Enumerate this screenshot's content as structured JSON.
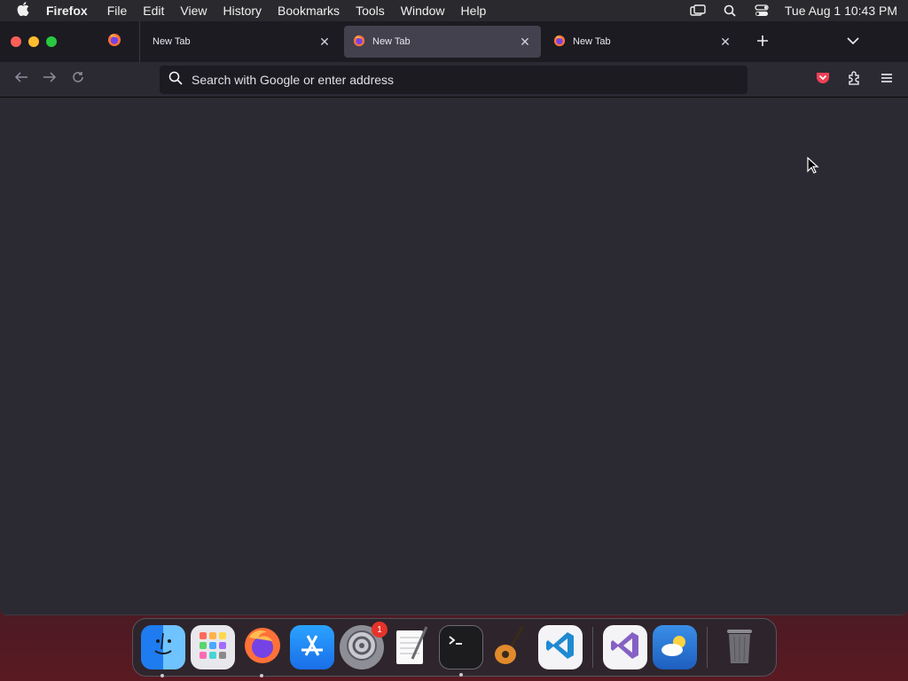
{
  "menubar": {
    "app_name": "Firefox",
    "items": [
      "File",
      "Edit",
      "View",
      "History",
      "Bookmarks",
      "Tools",
      "Window",
      "Help"
    ],
    "clock": "Tue Aug 1  10:43 PM"
  },
  "tabs": [
    {
      "label": "New Tab",
      "active": false
    },
    {
      "label": "New Tab",
      "active": true
    },
    {
      "label": "New Tab",
      "active": false
    }
  ],
  "urlbar": {
    "placeholder": "Search with Google or enter address"
  },
  "dock": {
    "items": [
      {
        "name": "Finder",
        "icon": "finder-icon"
      },
      {
        "name": "Launchpad",
        "icon": "launchpad-icon"
      },
      {
        "name": "Firefox",
        "icon": "firefox-icon"
      },
      {
        "name": "App Store",
        "icon": "app-store-icon"
      },
      {
        "name": "System Settings",
        "icon": "settings-icon",
        "badge": "1"
      },
      {
        "name": "TextEdit",
        "icon": "textedit-icon"
      },
      {
        "name": "Terminal",
        "icon": "terminal-icon"
      },
      {
        "name": "GarageBand",
        "icon": "guitar-icon"
      },
      {
        "name": "Visual Studio Code",
        "icon": "vscode-icon"
      },
      {
        "name": "Visual Studio",
        "icon": "visual-studio-icon"
      },
      {
        "name": "Weather",
        "icon": "weather-icon"
      },
      {
        "name": "Trash",
        "icon": "trash-icon"
      }
    ]
  },
  "colors": {
    "window_bg": "#2b2a33",
    "tabstrip_bg": "#1c1b22",
    "active_tab": "#42414d",
    "pocket": "#ef4056"
  }
}
